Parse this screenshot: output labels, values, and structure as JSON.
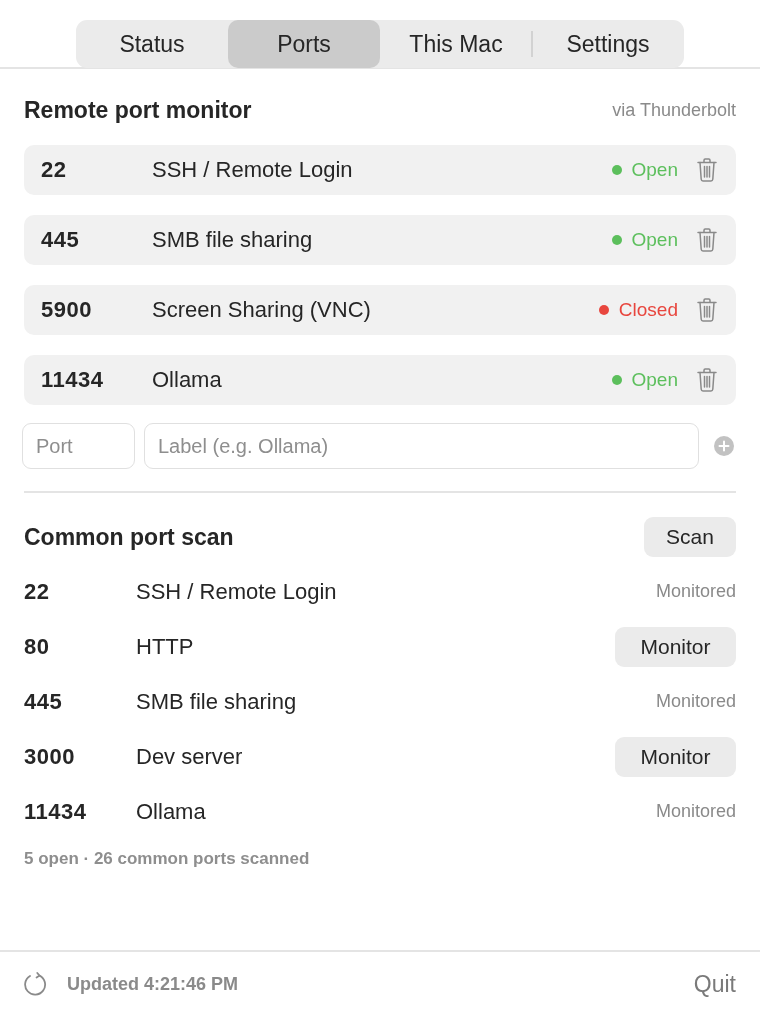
{
  "tabs": [
    {
      "label": "Status",
      "selected": false
    },
    {
      "label": "Ports",
      "selected": true
    },
    {
      "label": "This Mac",
      "selected": false
    },
    {
      "label": "Settings",
      "selected": false
    }
  ],
  "remote_monitor": {
    "title": "Remote port monitor",
    "connection": "via Thunderbolt",
    "ports": [
      {
        "port": "22",
        "label": "SSH / Remote Login",
        "status": "Open",
        "open": true
      },
      {
        "port": "445",
        "label": "SMB file sharing",
        "status": "Open",
        "open": true
      },
      {
        "port": "5900",
        "label": "Screen Sharing (VNC)",
        "status": "Closed",
        "open": false
      },
      {
        "port": "11434",
        "label": "Ollama",
        "status": "Open",
        "open": true
      }
    ]
  },
  "add_port_form": {
    "port_placeholder": "Port",
    "label_placeholder": "Label (e.g. Ollama)"
  },
  "common_scan": {
    "title": "Common port scan",
    "scan_button": "Scan",
    "results": [
      {
        "port": "22",
        "label": "SSH / Remote Login",
        "kind": "monitored",
        "action": "Monitored"
      },
      {
        "port": "80",
        "label": "HTTP",
        "kind": "button",
        "action": "Monitor"
      },
      {
        "port": "445",
        "label": "SMB file sharing",
        "kind": "monitored",
        "action": "Monitored"
      },
      {
        "port": "3000",
        "label": "Dev server",
        "kind": "button",
        "action": "Monitor"
      },
      {
        "port": "11434",
        "label": "Ollama",
        "kind": "monitored",
        "action": "Monitored"
      }
    ],
    "summary": "5 open · 26 common ports scanned"
  },
  "footer": {
    "updated": "Updated 4:21:46 PM",
    "quit": "Quit"
  }
}
